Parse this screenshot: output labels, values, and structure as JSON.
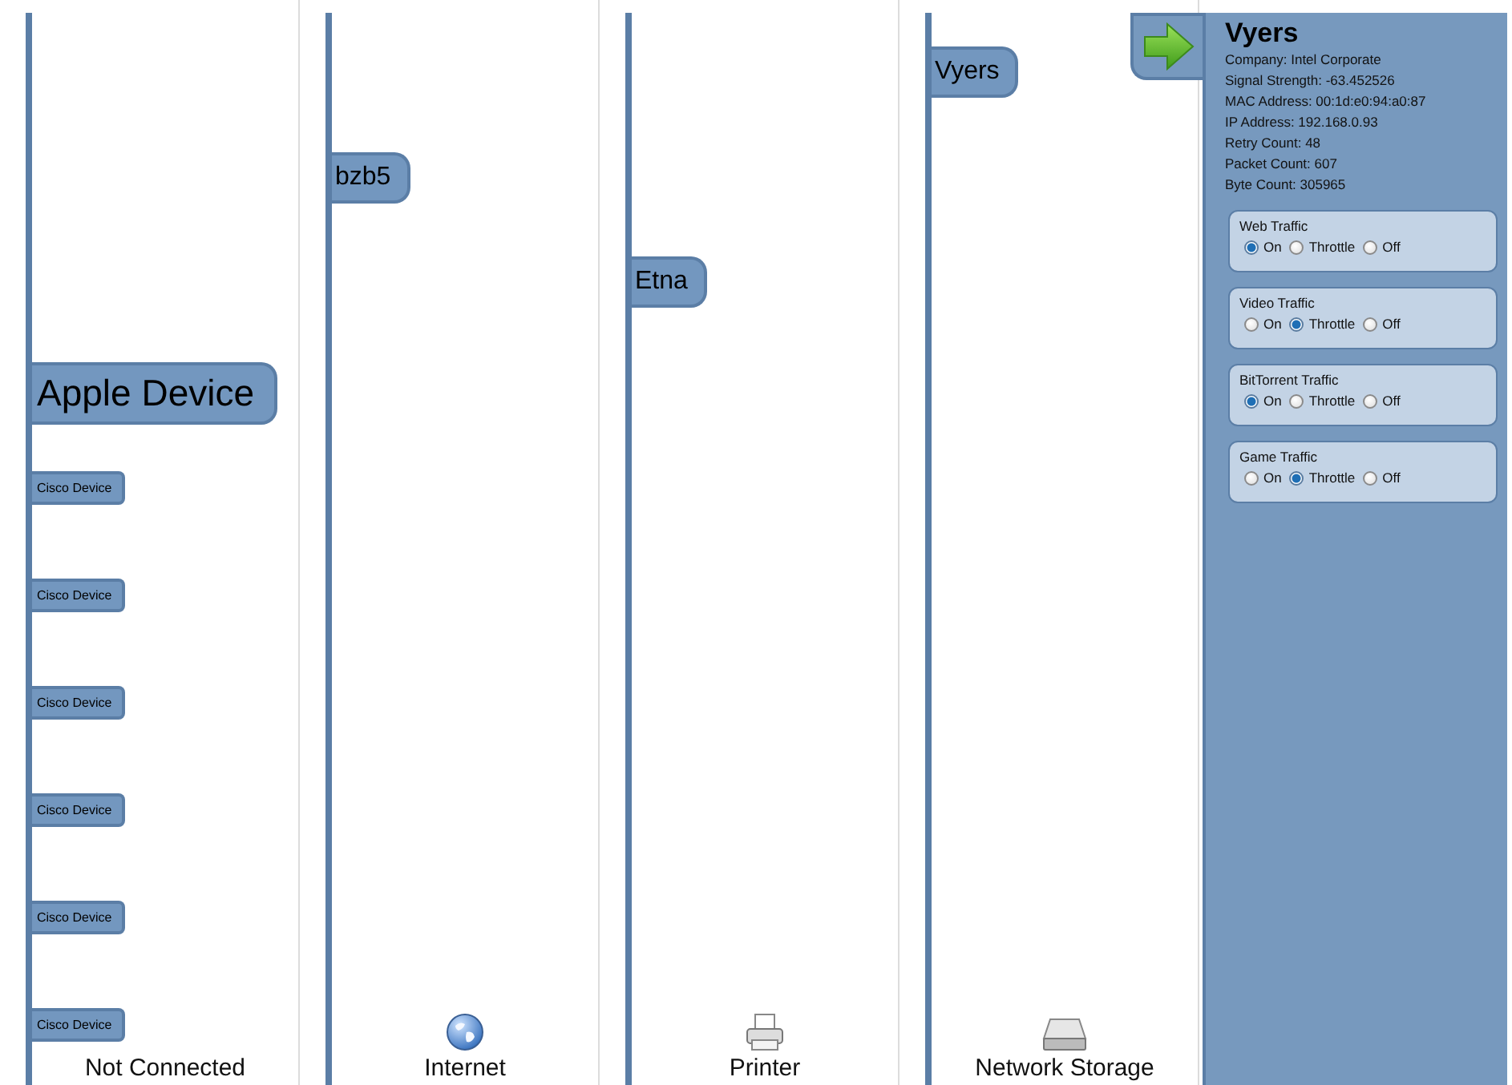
{
  "columns": [
    {
      "label": "Not Connected",
      "kind": "none",
      "devices": [
        {
          "name": "Apple Device",
          "kind": "large"
        },
        {
          "name": "Cisco Device",
          "kind": "small"
        },
        {
          "name": "Cisco Device",
          "kind": "small"
        },
        {
          "name": "Cisco Device",
          "kind": "small"
        },
        {
          "name": "Cisco Device",
          "kind": "small"
        },
        {
          "name": "Cisco Device",
          "kind": "small"
        },
        {
          "name": "Cisco Device",
          "kind": "small"
        }
      ]
    },
    {
      "label": "Internet",
      "kind": "globe",
      "devices": [
        {
          "name": "bzb5",
          "kind": "medium"
        }
      ]
    },
    {
      "label": "Printer",
      "kind": "printer",
      "devices": [
        {
          "name": "Etna",
          "kind": "medium"
        }
      ]
    },
    {
      "label": "Network Storage",
      "kind": "drive",
      "devices": [
        {
          "name": "Vyers",
          "kind": "medium"
        }
      ]
    }
  ],
  "details": {
    "name": "Vyers",
    "lines": [
      "Company: Intel Corporate",
      "Signal Strength: -63.452526",
      "MAC Address: 00:1d:e0:94:a0:87",
      "IP Address: 192.168.0.93",
      "Retry Count: 48",
      "Packet Count: 607",
      "Byte Count: 305965"
    ],
    "traffic": [
      {
        "label": "Web Traffic",
        "options": [
          {
            "label": "On",
            "selected": true
          },
          {
            "label": "Throttle",
            "selected": false
          },
          {
            "label": "Off",
            "selected": false
          }
        ]
      },
      {
        "label": "Video Traffic",
        "options": [
          {
            "label": "On",
            "selected": false
          },
          {
            "label": "Throttle",
            "selected": true
          },
          {
            "label": "Off",
            "selected": false
          }
        ]
      },
      {
        "label": "BitTorrent Traffic",
        "options": [
          {
            "label": "On",
            "selected": true
          },
          {
            "label": "Throttle",
            "selected": false
          },
          {
            "label": "Off",
            "selected": false
          }
        ]
      },
      {
        "label": "Game Traffic",
        "options": [
          {
            "label": "On",
            "selected": false
          },
          {
            "label": "Throttle",
            "selected": true
          },
          {
            "label": "Off",
            "selected": false
          }
        ]
      }
    ]
  }
}
